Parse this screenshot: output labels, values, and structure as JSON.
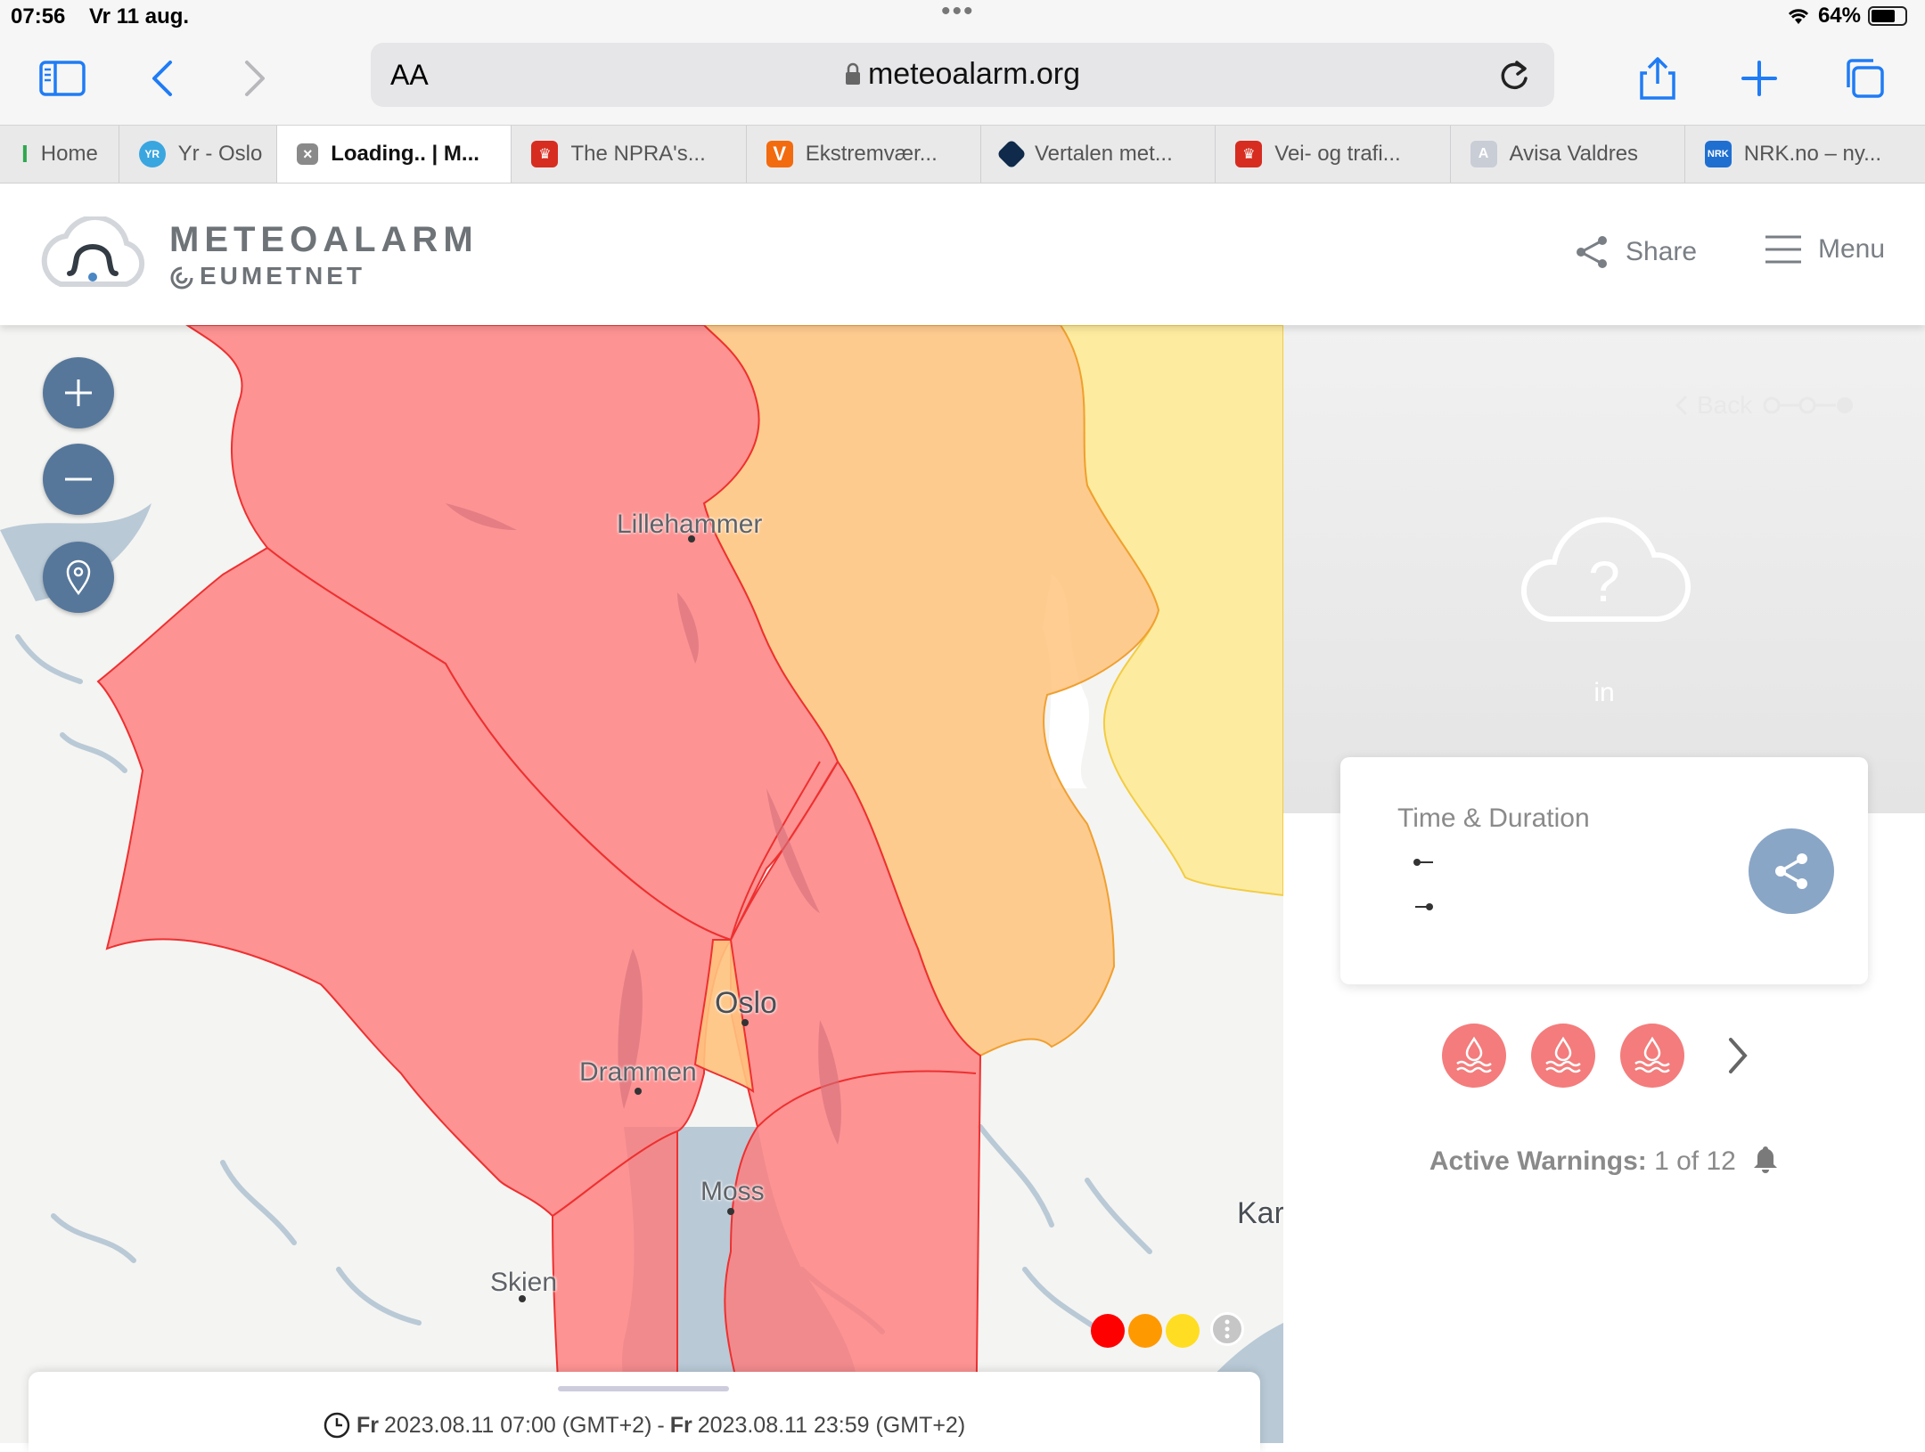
{
  "status_bar": {
    "time": "07:56",
    "date": "Vr 11 aug.",
    "battery": "64%"
  },
  "browser": {
    "text_size_label": "AA",
    "url": "meteoalarm.org",
    "tabs": [
      {
        "label": "Home",
        "favicon": "I",
        "color": "#2fa84f"
      },
      {
        "label": "Yr - Oslo",
        "favicon": "YR",
        "color": "#3aa6e0"
      },
      {
        "label": "Loading.. | M...",
        "favicon": "×",
        "color": "#777777"
      },
      {
        "label": "The NPRA's...",
        "favicon": "▣",
        "color": "#d62d20"
      },
      {
        "label": "Ekstremvær...",
        "favicon": "V",
        "color": "#f26b0f"
      },
      {
        "label": "Vertalen met...",
        "favicon": "◆",
        "color": "#0f2a4a"
      },
      {
        "label": "Vei- og trafi...",
        "favicon": "▣",
        "color": "#d62d20"
      },
      {
        "label": "Avisa Valdres",
        "favicon": "A",
        "color": "#c8cdd6"
      },
      {
        "label": "NRK.no – ny...",
        "favicon": "NRK",
        "color": "#1f6fd1"
      }
    ]
  },
  "site": {
    "brand_title": "METEOALARM",
    "brand_sub": "EUMETNET",
    "share_label": "Share",
    "menu_label": "Menu"
  },
  "map": {
    "labels": {
      "lillehammer": "Lillehammer",
      "oslo": "Oslo",
      "drammen": "Drammen",
      "moss": "Moss",
      "skien": "Skien",
      "kar": "Kar"
    },
    "legend_colors": [
      "#ff0000",
      "#ff9900",
      "#ffdd22"
    ],
    "timebar": {
      "day_from": "Fr",
      "from": "2023.08.11 07:00 (GMT+2)",
      "separator": "-",
      "day_to": "Fr",
      "to": "2023.08.11 23:59 (GMT+2)"
    }
  },
  "panel": {
    "back_label": "Back",
    "in_label": "in",
    "card_title": "Time & Duration",
    "active_label": "Active Warnings:",
    "active_value": "1 of 12"
  }
}
